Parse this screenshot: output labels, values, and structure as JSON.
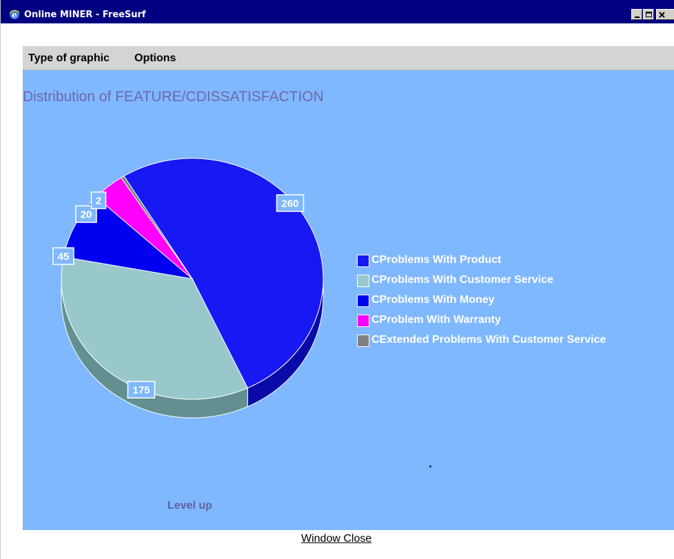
{
  "window": {
    "title": "Online MINER - FreeSurf",
    "icon": "internet-explorer-icon"
  },
  "menu": {
    "items": [
      "Type of graphic",
      "Options"
    ]
  },
  "chart_data": {
    "type": "pie",
    "title": "Distribution of FEATURE/CDISSATISFACTION",
    "categories": [
      "CProblems With Product",
      "CProblems With Customer Service",
      "CProblems With Money",
      "CProblem With Warranty",
      "CExtended Problems With Customer Service"
    ],
    "values": [
      260,
      175,
      45,
      20,
      2
    ],
    "colors": [
      "#1818f4",
      "#98c8cc",
      "#0000f0",
      "#ff00ff",
      "#808080"
    ],
    "side_colors": [
      "#0a0aa8",
      "#629090",
      "#0000a8",
      "#b000b0",
      "#585858"
    ],
    "legend_position": "right",
    "three_d": true
  },
  "links": {
    "level_up": "Level up",
    "window_close": "Window Close"
  },
  "colors": {
    "panel_background": "#80b8ff",
    "title_color": "#6c68a8",
    "menubar_background": "#d4d4d4"
  }
}
